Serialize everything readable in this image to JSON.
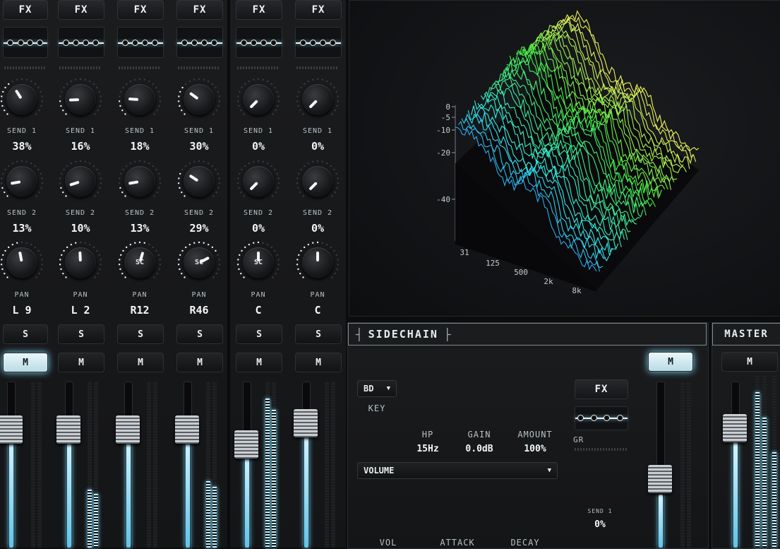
{
  "channels": [
    {
      "fx": "FX",
      "send1_label": "SEND 1",
      "send1": "38%",
      "send2_label": "SEND 2",
      "send2": "13%",
      "pan_label": "PAN",
      "pan": "L 9",
      "solo": "S",
      "mute": "M",
      "mute_active": true,
      "send1_level": 0.38,
      "send2_level": 0.13,
      "pan_level": 0.46,
      "pan_sc": "",
      "fader_level": 0.78,
      "meter_level": 0.0
    },
    {
      "fx": "FX",
      "send1_label": "SEND 1",
      "send1": "16%",
      "send2_label": "SEND 2",
      "send2": "10%",
      "pan_label": "PAN",
      "pan": "L 2",
      "solo": "S",
      "mute": "M",
      "mute_active": false,
      "send1_level": 0.16,
      "send2_level": 0.1,
      "pan_level": 0.49,
      "pan_sc": "",
      "fader_level": 0.78,
      "meter_level": 0.35
    },
    {
      "fx": "FX",
      "send1_label": "SEND 1",
      "send1": "18%",
      "send2_label": "SEND 2",
      "send2": "13%",
      "pan_label": "PAN",
      "pan": "R12",
      "solo": "S",
      "mute": "M",
      "mute_active": false,
      "send1_level": 0.18,
      "send2_level": 0.13,
      "pan_level": 0.56,
      "pan_sc": "SC",
      "fader_level": 0.78,
      "meter_level": 0.0
    },
    {
      "fx": "FX",
      "send1_label": "SEND 1",
      "send1": "30%",
      "send2_label": "SEND 2",
      "send2": "29%",
      "pan_label": "PAN",
      "pan": "R46",
      "solo": "S",
      "mute": "M",
      "mute_active": false,
      "send1_level": 0.3,
      "send2_level": 0.29,
      "pan_level": 0.73,
      "pan_sc": "SC",
      "fader_level": 0.78,
      "meter_level": 0.4
    },
    {
      "fx": "FX",
      "send1_label": "SEND 1",
      "send1": "0%",
      "send2_label": "SEND 2",
      "send2": "0%",
      "pan_label": "PAN",
      "pan": "C",
      "solo": "S",
      "mute": "M",
      "mute_active": false,
      "send1_level": 0.0,
      "send2_level": 0.0,
      "pan_level": 0.5,
      "pan_sc": "SC",
      "fader_level": 0.62,
      "meter_level": 0.9
    },
    {
      "fx": "FX",
      "send1_label": "SEND 1",
      "send1": "0%",
      "send2_label": "SEND 2",
      "send2": "0%",
      "pan_label": "PAN",
      "pan": "C",
      "solo": "S",
      "mute": "M",
      "mute_active": false,
      "send1_level": 0.0,
      "send2_level": 0.0,
      "pan_level": 0.5,
      "pan_sc": "",
      "fader_level": 0.85,
      "meter_level": 0.0
    }
  ],
  "spectrum": {
    "y_ticks": [
      "0",
      "-5",
      "-10",
      "-20",
      "-40"
    ],
    "x_ticks": [
      "31",
      "125",
      "500",
      "2k",
      "8k"
    ]
  },
  "sidechain": {
    "title": "SIDECHAIN",
    "key_value": "BD",
    "key_label": "KEY",
    "hp_label": "HP",
    "hp_value": "15Hz",
    "hp_level": 0.15,
    "gain_label": "GAIN",
    "gain_value": "0.0dB",
    "gain_level": 0.5,
    "amount_label": "AMOUNT",
    "amount_value": "100%",
    "amount_level": 1.0,
    "mode_value": "VOLUME",
    "vol_label": "VOL",
    "attack_label": "ATTACK",
    "decay_label": "DECAY",
    "fx": "FX",
    "gr_label": "GR",
    "send1_label": "SEND 1",
    "send1": "0%",
    "mute": "M",
    "mute_active": true
  },
  "master": {
    "title": "MASTER",
    "mute": "M"
  },
  "colors": {
    "accent": "#7fd4f0",
    "panel": "#1a1b1d",
    "background": "#0b0c0d"
  }
}
